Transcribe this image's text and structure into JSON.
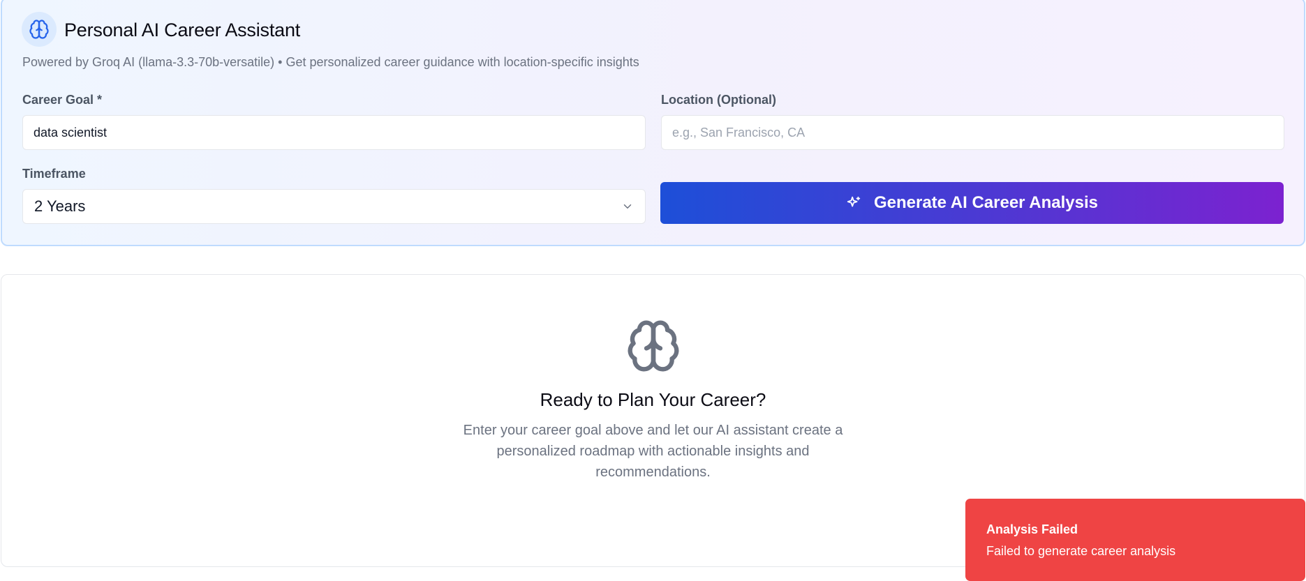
{
  "header": {
    "title": "Personal AI Career Assistant",
    "subtitle": "Powered by Groq AI (llama-3.3-70b-versatile) • Get personalized career guidance with location-specific insights",
    "icon": "brain-icon"
  },
  "form": {
    "career_goal_label": "Career Goal *",
    "career_goal_value": "data scientist",
    "location_label": "Location (Optional)",
    "location_placeholder": "e.g., San Francisco, CA",
    "location_value": "",
    "timeframe_label": "Timeframe",
    "timeframe_value": "2 Years",
    "generate_label": "Generate AI Career Analysis",
    "generate_icon": "sparkles-icon"
  },
  "empty_state": {
    "icon": "brain-icon",
    "title": "Ready to Plan Your Career?",
    "description": "Enter your career goal above and let our AI assistant create a personalized roadmap with actionable insights and recommendations."
  },
  "toast": {
    "title": "Analysis Failed",
    "description": "Failed to generate career analysis",
    "color": "#ef4444"
  },
  "colors": {
    "accent_blue": "#1d4fd8",
    "accent_purple": "#7c22d0",
    "card_border": "#bfdbfe"
  }
}
